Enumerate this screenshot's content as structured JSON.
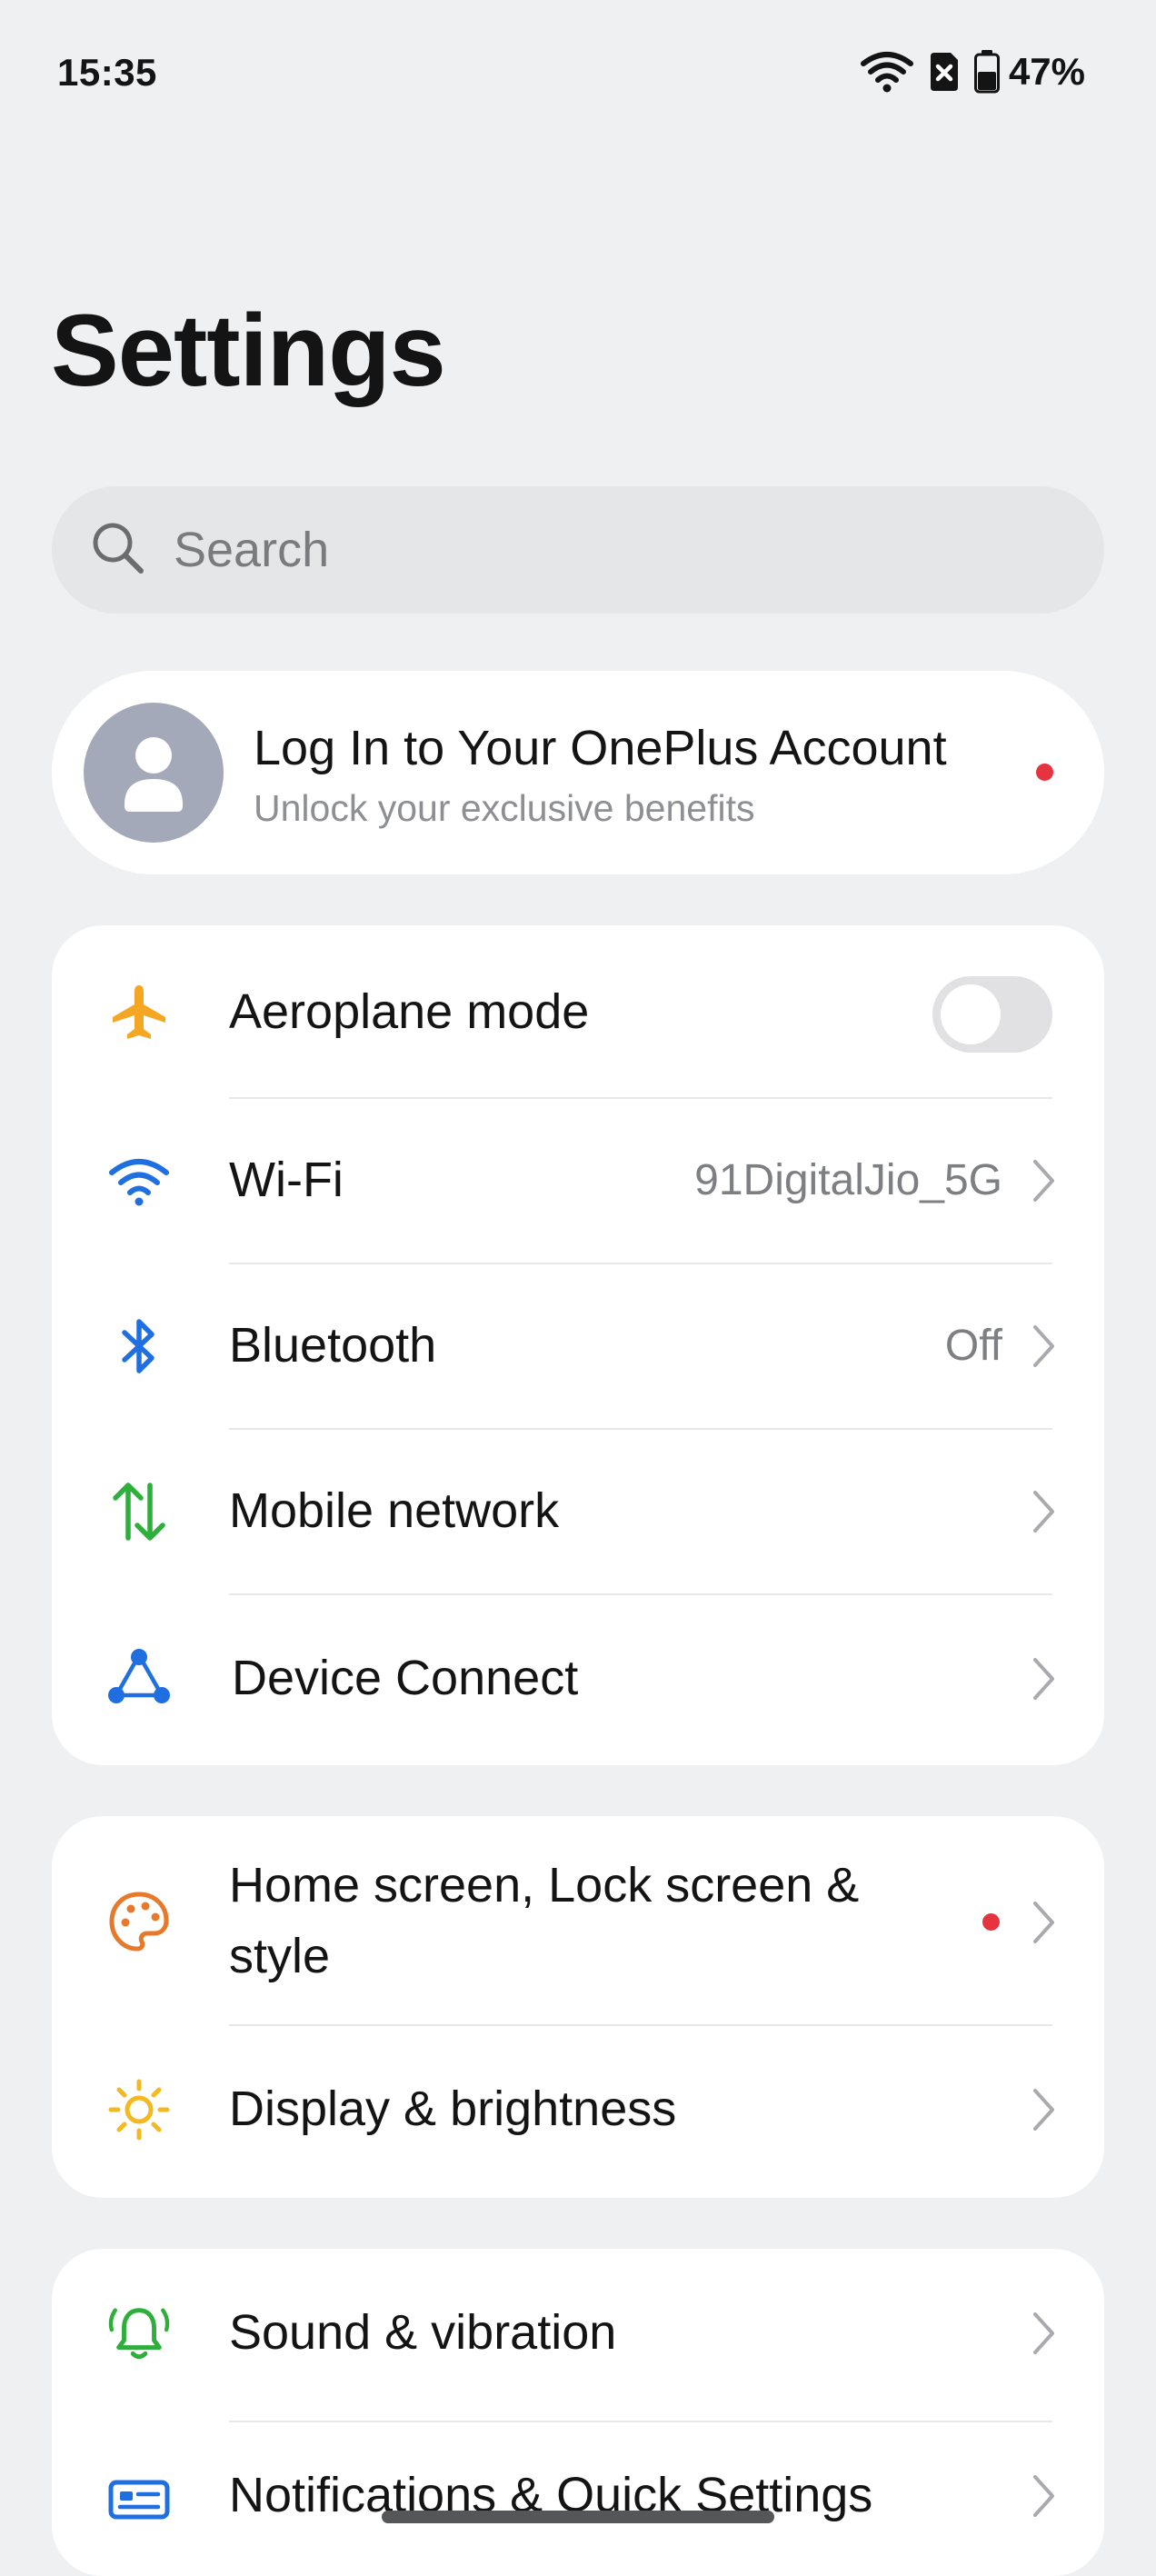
{
  "status_bar": {
    "time": "15:35",
    "battery_percent": "47%",
    "icons": [
      "wifi-icon",
      "no-sim-icon",
      "battery-icon"
    ]
  },
  "page": {
    "title": "Settings"
  },
  "search": {
    "placeholder": "Search"
  },
  "account": {
    "title": "Log In to Your OnePlus Account",
    "subtitle": "Unlock your exclusive benefits",
    "has_notification_dot": true
  },
  "connectivity": {
    "aeroplane": {
      "label": "Aeroplane mode",
      "toggle_on": false,
      "icon": "airplane-icon"
    },
    "wifi": {
      "label": "Wi-Fi",
      "value": "91DigitalJio_5G",
      "icon": "wifi-icon"
    },
    "bluetooth": {
      "label": "Bluetooth",
      "value": "Off",
      "icon": "bluetooth-icon"
    },
    "mobile": {
      "label": "Mobile network",
      "icon": "mobile-data-icon"
    },
    "device_connect": {
      "label": "Device Connect",
      "icon": "device-connect-icon"
    }
  },
  "personalization": {
    "home_screen": {
      "label_line1": "Home screen, Lock screen &",
      "label_line2": "style",
      "icon": "palette-icon",
      "has_notification_dot": true
    },
    "display": {
      "label": "Display & brightness",
      "icon": "sun-icon"
    }
  },
  "sound_group": {
    "sound": {
      "label": "Sound & vibration",
      "icon": "bell-icon"
    },
    "notifications": {
      "label": "Notifications & Quick Settings",
      "icon": "notification-card-icon"
    }
  },
  "colors": {
    "background": "#eff0f2",
    "card": "#ffffff",
    "airplane_icon": "#f5a623",
    "blue_icon": "#1f6fe0",
    "green_icon": "#2eae3a",
    "orange_icon": "#e8782a",
    "yellow_icon": "#f4b821",
    "notification_dot": "#e5333f"
  }
}
